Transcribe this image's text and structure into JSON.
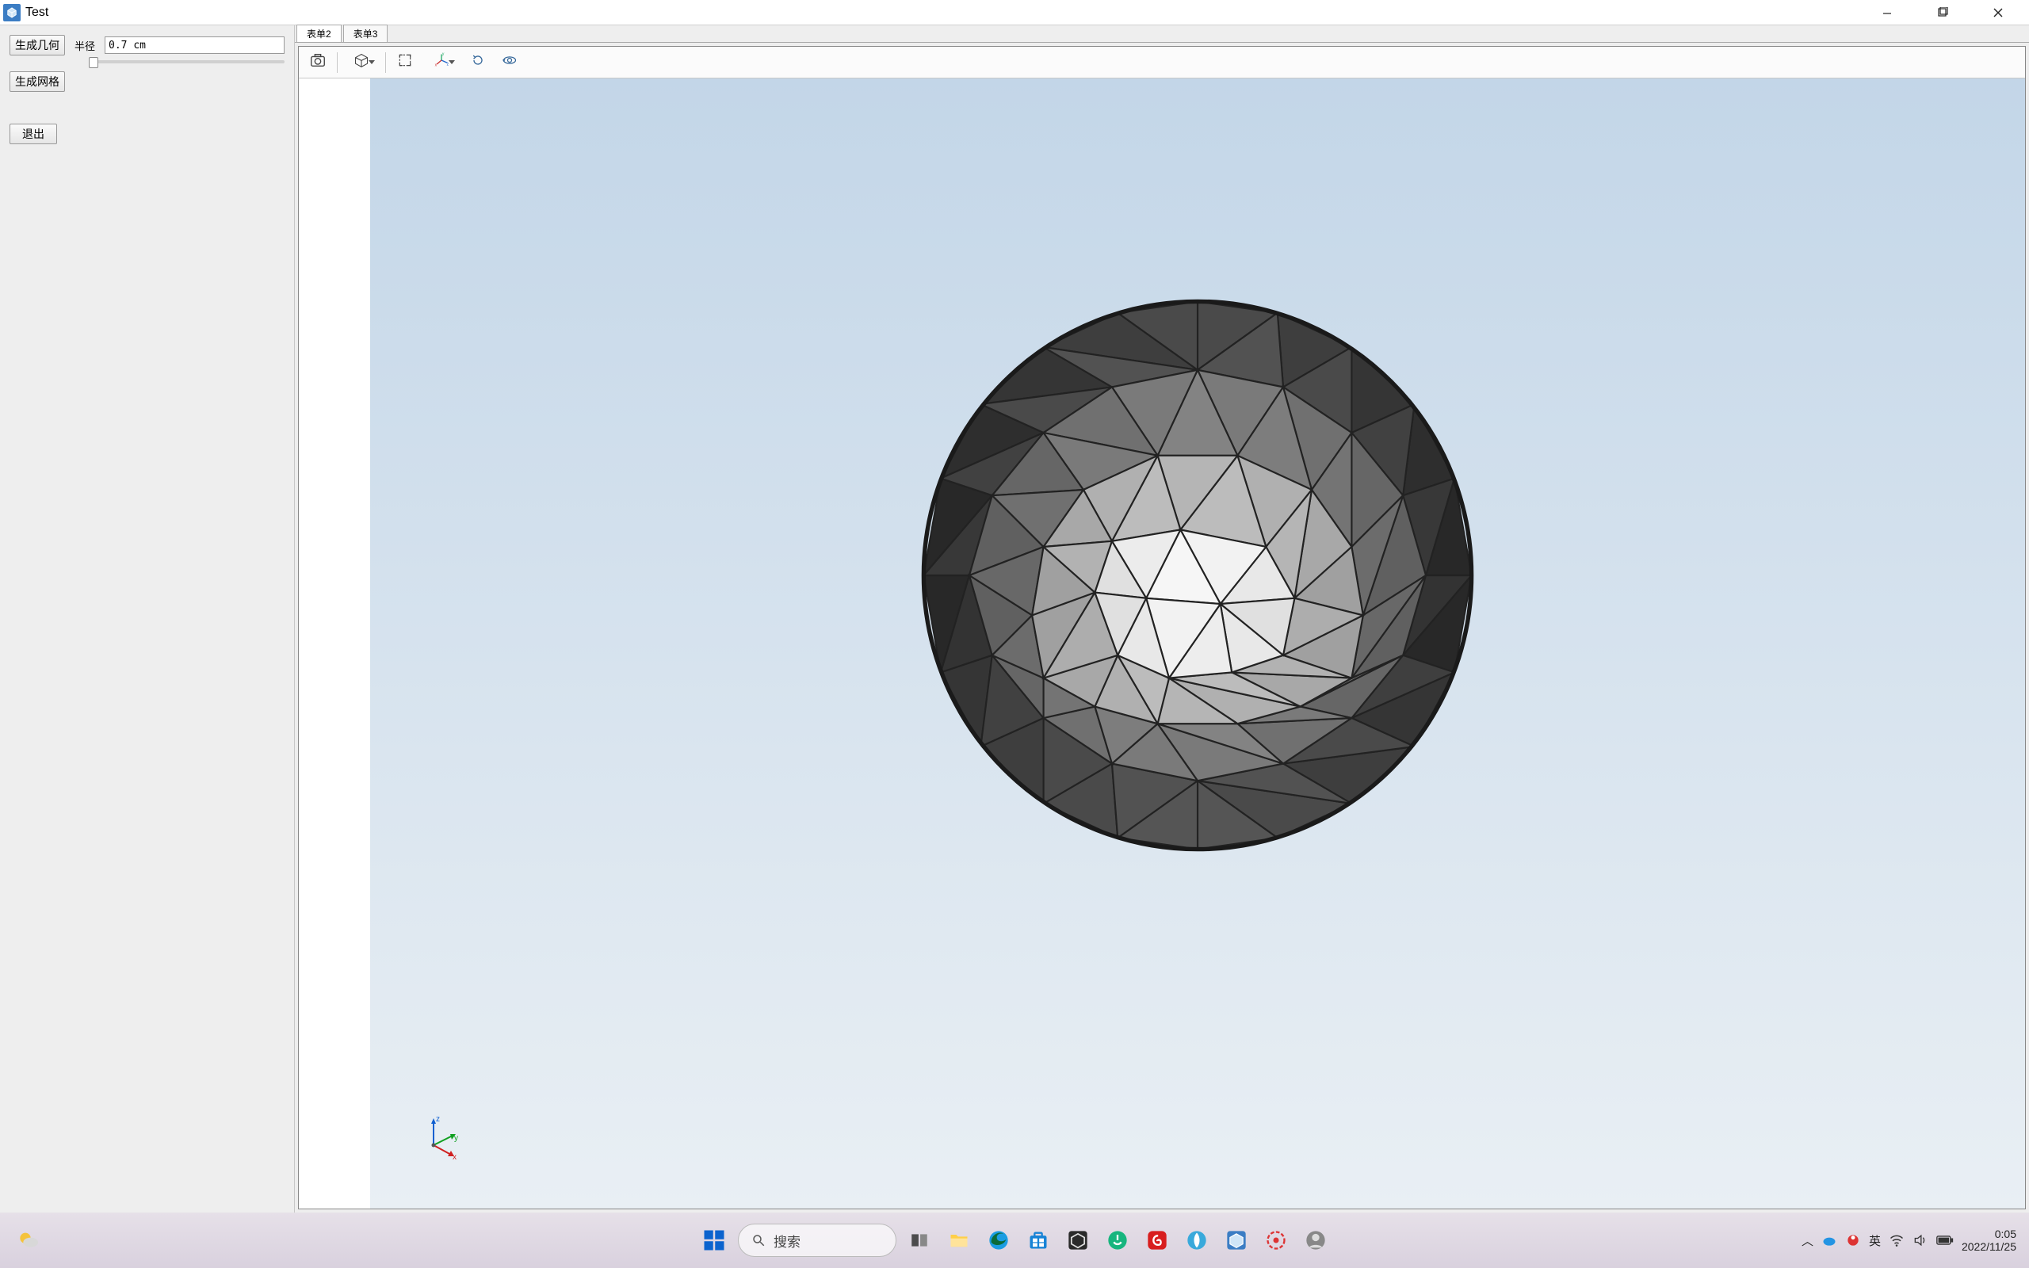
{
  "window": {
    "title": "Test",
    "controls": {
      "min": "—",
      "max": "❐",
      "close": "✕"
    }
  },
  "sidebar": {
    "gen_geometry": "生成几何",
    "radius_label": "半径",
    "radius_value": "0.7 cm",
    "gen_mesh": "生成网格",
    "exit": "退出"
  },
  "tabs": {
    "t1": "表单2",
    "t2": "表单3"
  },
  "toolbar": {
    "screenshot": "camera",
    "view_cube": "cube",
    "zoom_extents": "fit",
    "axes": "axes",
    "rotate": "rotate",
    "orbit": "orbit"
  },
  "axis": {
    "x": "x",
    "y": "y",
    "z": "z"
  },
  "taskbar": {
    "search": "搜索",
    "ime": "英",
    "clock_time": "0:05",
    "clock_date": "2022/11/25"
  }
}
